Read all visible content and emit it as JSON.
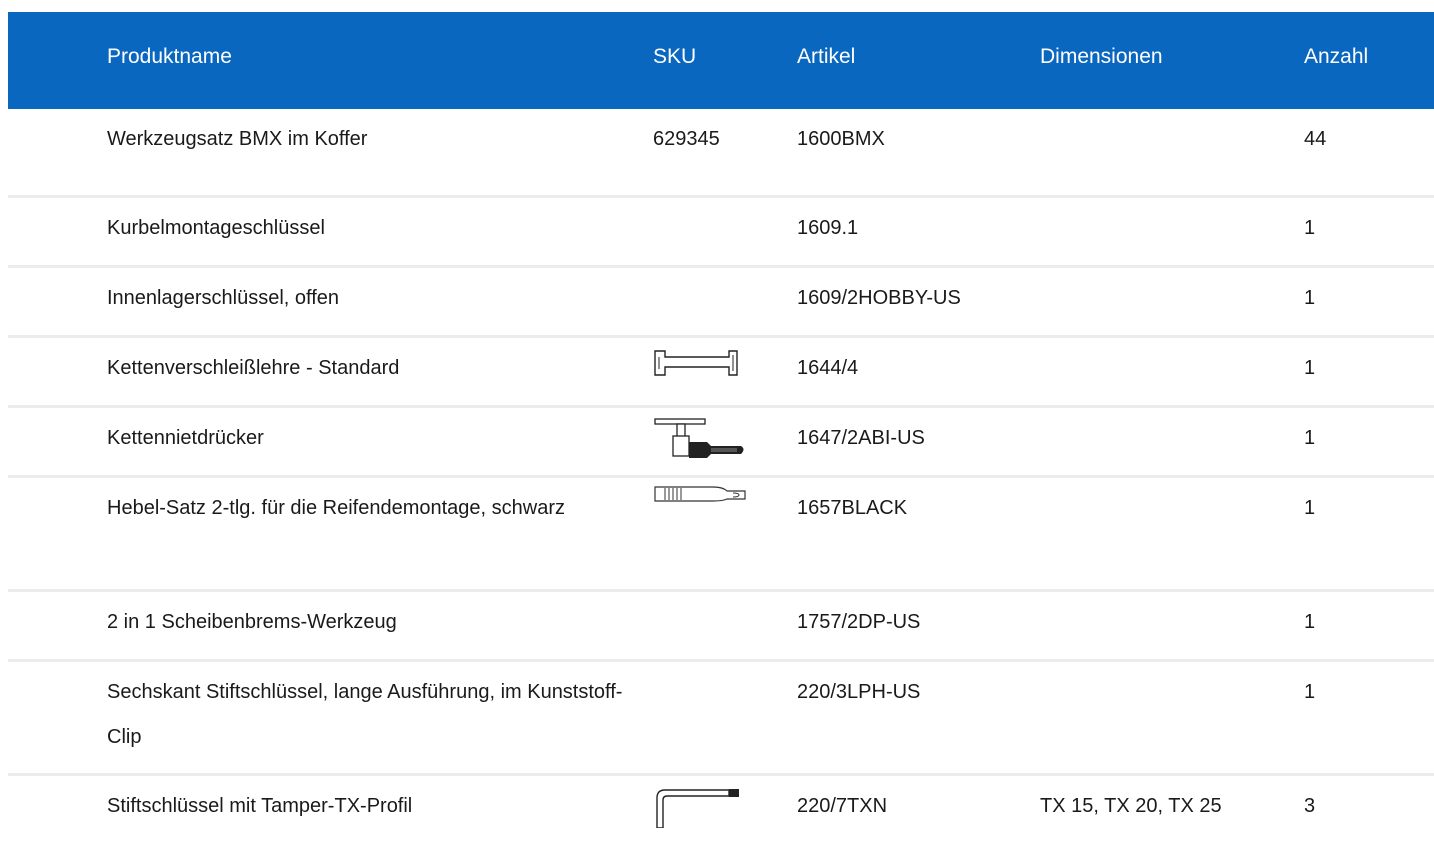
{
  "header": {
    "name": "Produktname",
    "sku": "SKU",
    "article": "Artikel",
    "dimensions": "Dimensionen",
    "quantity": "Anzahl"
  },
  "rows": [
    {
      "name": "Werkzeugsatz BMX im Koffer",
      "sku": "629345",
      "article": "1600BMX",
      "dimensions": "",
      "quantity": "44",
      "icon": ""
    },
    {
      "name": "Kurbelmontageschlüssel",
      "sku": "",
      "article": "1609.1",
      "dimensions": "",
      "quantity": "1",
      "icon": ""
    },
    {
      "name": "Innenlagerschlüssel, offen",
      "sku": "",
      "article": "1609/2HOBBY-US",
      "dimensions": "",
      "quantity": "1",
      "icon": ""
    },
    {
      "name": "Kettenverschleißlehre - Standard",
      "sku": "",
      "article": "1644/4",
      "dimensions": "",
      "quantity": "1",
      "icon": "chain-wear-gauge-icon"
    },
    {
      "name": "Kettennietdrücker",
      "sku": "",
      "article": "1647/2ABI-US",
      "dimensions": "",
      "quantity": "1",
      "icon": "chain-tool-icon"
    },
    {
      "name": "Hebel-Satz 2-tlg. für die Reifendemontage, schwarz",
      "sku": "",
      "article": "1657BLACK",
      "dimensions": "",
      "quantity": "1",
      "icon": "tire-lever-icon"
    },
    {
      "name": "2 in 1 Scheibenbrems-Werkzeug",
      "sku": "",
      "article": "1757/2DP-US",
      "dimensions": "",
      "quantity": "1",
      "icon": ""
    },
    {
      "name": "Sechskant Stiftschlüssel, lange Ausführung, im Kunststoff-Clip",
      "sku": "",
      "article": "220/3LPH-US",
      "dimensions": "",
      "quantity": "1",
      "icon": ""
    },
    {
      "name": "Stiftschlüssel mit Tamper-TX-Profil",
      "sku": "",
      "article": "220/7TXN",
      "dimensions": "TX 15, TX 20, TX 25",
      "quantity": "3",
      "icon": "torx-key-icon"
    }
  ],
  "colors": {
    "header_bg": "#0a67c0",
    "header_text": "#ffffff",
    "row_divider": "#ececec"
  }
}
